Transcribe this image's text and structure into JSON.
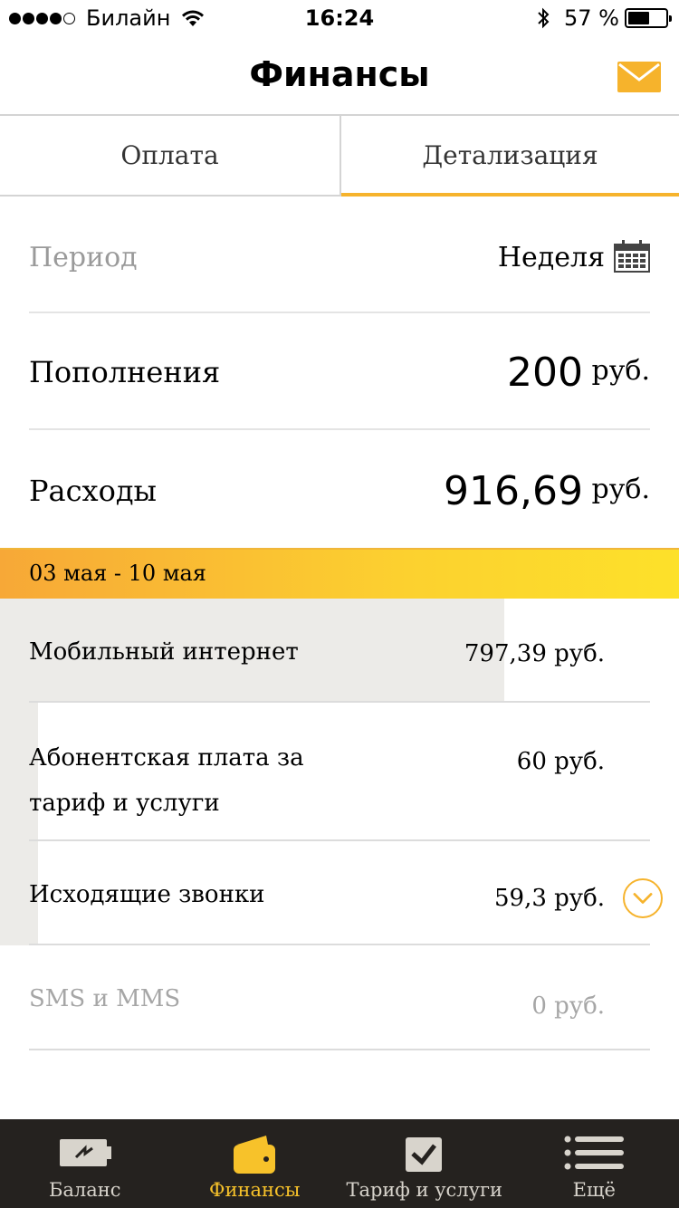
{
  "status_bar": {
    "carrier": "Билайн",
    "time": "16:24",
    "battery": "57 %",
    "battery_level": 0.57
  },
  "header": {
    "title": "Финансы",
    "mail_icon": "mail-icon"
  },
  "tabs": [
    {
      "label": "Оплата",
      "active": false
    },
    {
      "label": "Детализация",
      "active": true
    }
  ],
  "period": {
    "label": "Период",
    "value": "Неделя",
    "icon": "calendar-icon"
  },
  "summary": {
    "topup_label": "Пополнения",
    "topup_amount": "200",
    "topup_unit": "руб.",
    "spend_label": "Расходы",
    "spend_amount": "916,69",
    "spend_unit": "руб."
  },
  "date_range": "03 мая - 10 мая",
  "expenses": [
    {
      "label": "Мобильный интернет",
      "amount": "797,39 руб.",
      "share": 0.87
    },
    {
      "label": "Абонентская плата за тариф и услуги",
      "line1": "Абонентская плата за",
      "line2": "тариф и услуги",
      "amount": "60 руб.",
      "share": 0.065
    },
    {
      "label": "Исходящие звонки",
      "amount": "59,3 руб.",
      "share": 0.065
    },
    {
      "label": "SMS и MMS",
      "amount": "0 руб.",
      "share": 0
    }
  ],
  "tabbar": [
    {
      "label": "Баланс",
      "icon": "battery-bolt-icon",
      "active": false
    },
    {
      "label": "Финансы",
      "icon": "wallet-icon",
      "active": true
    },
    {
      "label": "Тариф и услуги",
      "icon": "checkbox-icon",
      "active": false
    },
    {
      "label": "Ещё",
      "icon": "more-list-icon",
      "active": false
    }
  ],
  "colors": {
    "accent": "#f6b32c",
    "tabbar_bg": "#25221f",
    "tabbar_active": "#f7c22a",
    "bar_fill": "#ecebe8"
  }
}
